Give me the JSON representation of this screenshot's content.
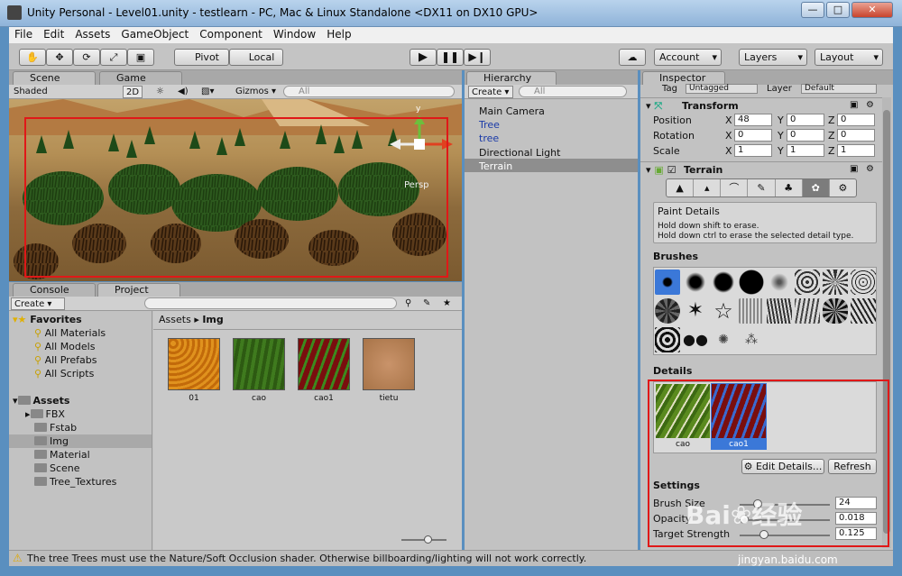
{
  "window": {
    "title": "Unity Personal - Level01.unity - testlearn - PC, Mac & Linux Standalone <DX11 on DX10 GPU>",
    "min": "—",
    "max": "□",
    "close": "✕"
  },
  "menu": [
    "File",
    "Edit",
    "Assets",
    "GameObject",
    "Component",
    "Window",
    "Help"
  ],
  "toolbar": {
    "pivot": "Pivot",
    "local": "Local",
    "account": "Account",
    "layers": "Layers",
    "layout": "Layout"
  },
  "scene": {
    "tab_scene": "Scene",
    "tab_game": "Game",
    "shading": "Shaded",
    "mode": "2D",
    "gizmos": "Gizmos",
    "search_placeholder": "All",
    "persp": "Persp",
    "axis_y": "y"
  },
  "project": {
    "tab_console": "Console",
    "tab_project": "Project",
    "create": "Create",
    "favorites_label": "Favorites",
    "favorites": [
      "All Materials",
      "All Models",
      "All Prefabs",
      "All Scripts"
    ],
    "assets_label": "Assets",
    "folders": [
      "FBX",
      "Fstab",
      "Img",
      "Material",
      "Scene",
      "Tree_Textures"
    ],
    "breadcrumb_root": "Assets",
    "breadcrumb_sep": "▸",
    "breadcrumb_current": "Img",
    "files": [
      "01",
      "cao",
      "cao1",
      "tietu"
    ]
  },
  "hierarchy": {
    "tab": "Hierarchy",
    "create": "Create",
    "search_placeholder": "All",
    "items": [
      "Main Camera",
      "Tree",
      "tree",
      "Directional Light",
      "Terrain"
    ]
  },
  "inspector": {
    "tab": "Inspector",
    "tag_label": "Tag",
    "tag_value": "Untagged",
    "layer_label": "Layer",
    "layer_value": "Default",
    "transform": {
      "title": "Transform",
      "rows": [
        {
          "label": "Position",
          "x": "48",
          "y": "0",
          "z": "0"
        },
        {
          "label": "Rotation",
          "x": "0",
          "y": "0",
          "z": "0"
        },
        {
          "label": "Scale",
          "x": "1",
          "y": "1",
          "z": "1"
        }
      ]
    },
    "terrain": {
      "title": "Terrain",
      "paint_title": "Paint Details",
      "help1": "Hold down shift to erase.",
      "help2": "Hold down ctrl to erase the selected detail type.",
      "brushes_label": "Brushes",
      "details_label": "Details",
      "details": [
        "cao",
        "cao1"
      ],
      "edit_details": "Edit Details...",
      "refresh": "Refresh",
      "settings_label": "Settings",
      "brush_size_label": "Brush Size",
      "brush_size": "24",
      "opacity_label": "Opacity",
      "opacity": "0.018",
      "target_label": "Target Strength",
      "target": "0.125"
    }
  },
  "status": {
    "message": "The tree Trees must use the Nature/Soft Occlusion shader. Otherwise billboarding/lighting will not work correctly."
  },
  "watermark": {
    "brand": "Bai",
    "brand2": "经验",
    "url": "jingyan.baidu.com"
  }
}
